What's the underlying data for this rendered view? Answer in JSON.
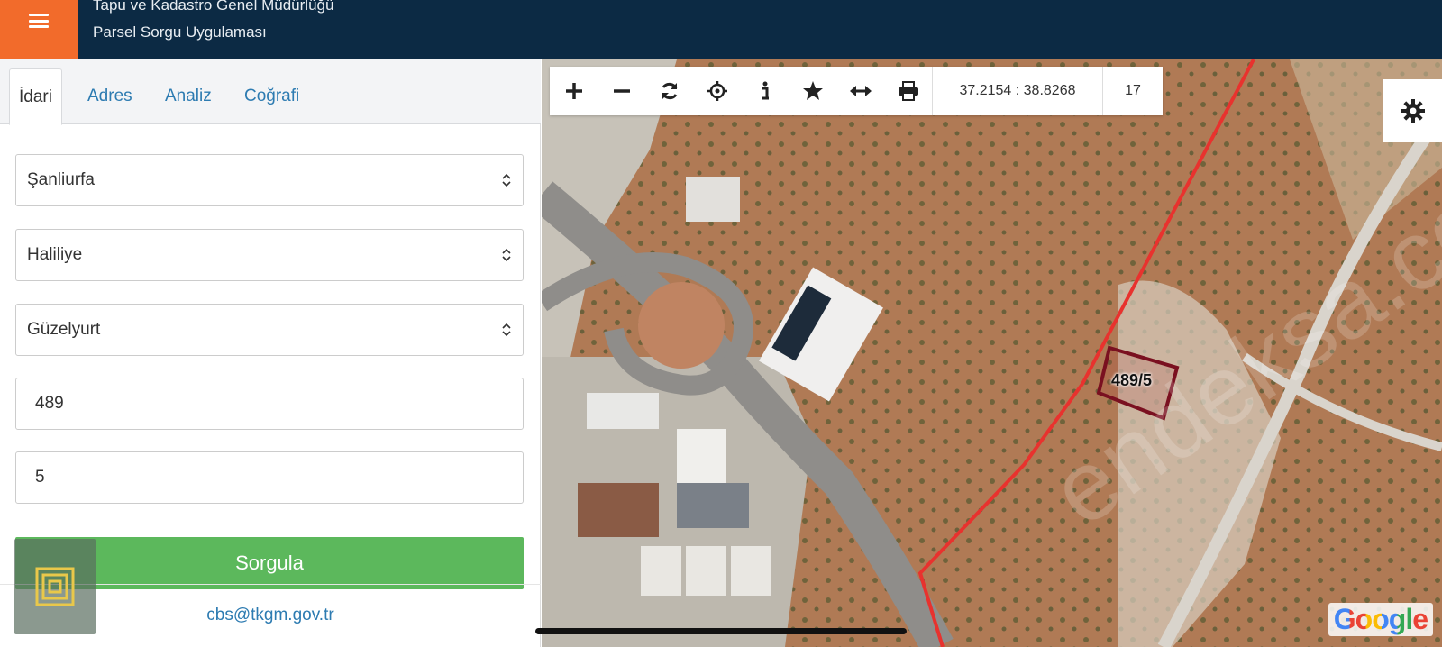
{
  "header": {
    "organization": "Tapu ve Kadastro Genel Müdürlüğü",
    "app_title": "Parsel Sorgu Uygulaması",
    "menu_icon": "hamburger-icon",
    "accent_color": "#f26b2b",
    "bar_color": "#0c2a44"
  },
  "sidebar": {
    "tabs": [
      {
        "label": "İdari",
        "active": true
      },
      {
        "label": "Adres",
        "active": false
      },
      {
        "label": "Analiz",
        "active": false
      },
      {
        "label": "Coğrafi",
        "active": false
      }
    ],
    "province": "Şanliurfa",
    "district": "Haliliye",
    "neighborhood": "Güzelyurt",
    "block": "489",
    "parcel": "5",
    "submit_label": "Sorgula",
    "submit_color": "#5cb85c",
    "contact_email": "cbs@tkgm.gov.tr"
  },
  "map": {
    "toolbar": {
      "icons": [
        "zoom-in-icon",
        "zoom-out-icon",
        "refresh-icon",
        "locate-icon",
        "info-icon",
        "bookmark-star-icon",
        "measure-icon",
        "print-icon"
      ],
      "coordinates": "37.2154 : 38.8268",
      "zoom_level": "17"
    },
    "settings_icon": "gear-icon",
    "parcel_label": "489/5",
    "attribution": "Google",
    "boundary_color": "#e8322e",
    "parcel_color": "#7a1020"
  }
}
